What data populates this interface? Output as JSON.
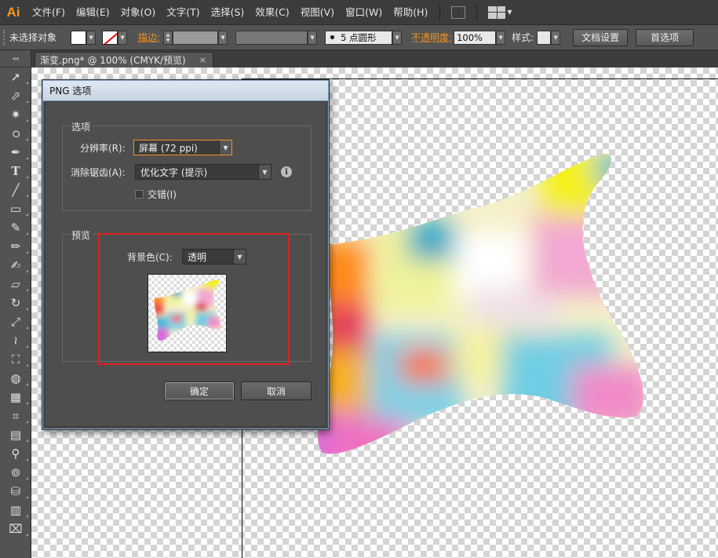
{
  "app": {
    "logo": "Ai"
  },
  "menu": [
    "文件(F)",
    "编辑(E)",
    "对象(O)",
    "文字(T)",
    "选择(S)",
    "效果(C)",
    "视图(V)",
    "窗口(W)",
    "帮助(H)"
  ],
  "control_bar": {
    "selection_status": "未选择对象",
    "stroke_label": "描边:",
    "brush_size": "5",
    "brush_shape": "点圆形",
    "opacity_label": "不透明度:",
    "opacity_value": "100%",
    "style_label": "样式:",
    "doc_setup_button": "文档设置",
    "preferences_button": "首选项"
  },
  "document_tab": {
    "title": "渐变.png* @ 100% (CMYK/预览)",
    "close": "×"
  },
  "dialog": {
    "title": "PNG 选项",
    "options_group": "选项",
    "resolution_label": "分辨率(R):",
    "resolution_value": "屏幕 (72 ppi)",
    "antialias_label": "消除锯齿(A):",
    "antialias_value": "优化文字 (提示)",
    "interlace_label": "交错(I)",
    "interlace_checked": false,
    "preview_group": "预览",
    "bg_color_label": "背景色(C):",
    "bg_color_value": "透明",
    "ok_button": "确定",
    "cancel_button": "取消"
  },
  "colors": {
    "accent_orange": "#f7941d",
    "highlight_red": "#e02020",
    "title_bar": "#c5d3e2"
  }
}
